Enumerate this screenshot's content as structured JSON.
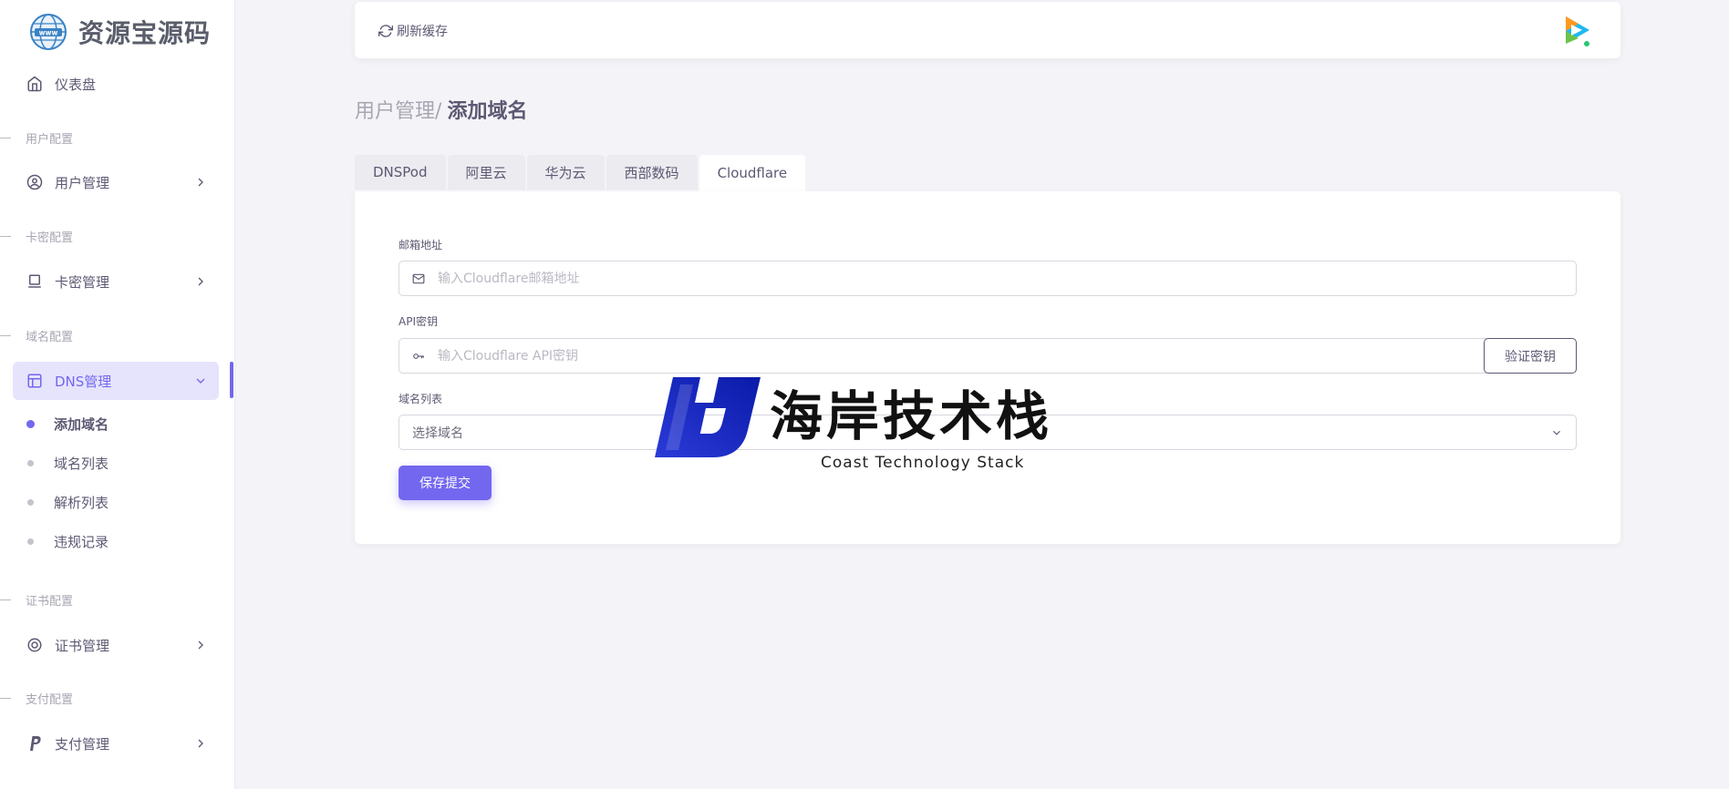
{
  "brand": {
    "name": "资源宝源码"
  },
  "sidebar": {
    "dashboard": "仪表盘",
    "sections": {
      "user": "用户配置",
      "card": "卡密配置",
      "domain": "域名配置",
      "cert": "证书配置",
      "pay": "支付配置"
    },
    "items": {
      "user_mgmt": "用户管理",
      "card_mgmt": "卡密管理",
      "dns_mgmt": "DNS管理",
      "cert_mgmt": "证书管理",
      "pay_mgmt": "支付管理"
    },
    "dns_sub": [
      "添加域名",
      "域名列表",
      "解析列表",
      "违规记录"
    ]
  },
  "navbar": {
    "refresh": "刷新缓存"
  },
  "breadcrumb": {
    "parent": "用户管理",
    "separator": "/",
    "current": "添加域名"
  },
  "tabs": [
    "DNSPod",
    "阿里云",
    "华为云",
    "西部数码",
    "Cloudflare"
  ],
  "active_tab": "Cloudflare",
  "form": {
    "email_label": "邮箱地址",
    "email_placeholder": "输入Cloudflare邮箱地址",
    "api_label": "API密钥",
    "api_placeholder": "输入Cloudflare API密钥",
    "verify_button": "验证密钥",
    "domain_label": "域名列表",
    "domain_select": "选择域名",
    "save_button": "保存提交"
  },
  "watermark": {
    "title": "海岸技术栈",
    "subtitle": "Coast Technology Stack"
  },
  "colors": {
    "primary": "#7367f0",
    "text": "#5e5873",
    "muted": "#a7a6b2",
    "background": "#f4f4f8"
  }
}
